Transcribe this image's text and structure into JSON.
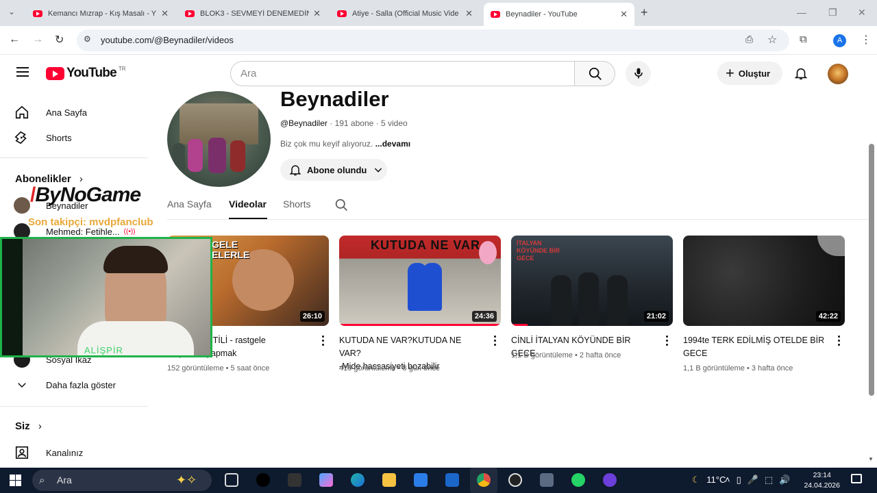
{
  "browser": {
    "tabs": [
      {
        "title": "Kemancı Mızrap - Kış Masalı - Y"
      },
      {
        "title": "BLOK3 - SEVMEYİ DENEMEDİN"
      },
      {
        "title": "Atiye - Salla (Official Music Vide"
      },
      {
        "title": "Beynadiler - YouTube"
      }
    ],
    "url": "youtube.com/@Beynadiler/videos",
    "profile_initial": "A"
  },
  "masthead": {
    "logo_text": "YouTube",
    "region": "TR",
    "search_placeholder": "Ara",
    "create_label": "Oluştur"
  },
  "sidebar": {
    "home": "Ana Sayfa",
    "shorts": "Shorts",
    "subscriptions_title": "Abonelikler",
    "subscriptions": [
      {
        "name": "Beynadiler"
      },
      {
        "name": "Mehmed: Fetihle..."
      },
      {
        "name": "Sosyal İkaz"
      }
    ],
    "show_more": "Daha fazla göster",
    "you_title": "Siz",
    "your_channel": "Kanalınız"
  },
  "channel": {
    "name": "Beynadiler",
    "handle": "@Beynadiler",
    "subscribers": "191 abone",
    "video_count": "5 video",
    "description": "Biz çok mu keyif alıyoruz.",
    "more": "...devamı",
    "subscribed_label": "Abone olundu",
    "tabs": [
      "Ana Sayfa",
      "Videolar",
      "Shorts"
    ],
    "active_tab": "Videolar"
  },
  "videos": [
    {
      "title_line1": "ME GARANTİLİ - rastgele",
      "title_line2": "rle yemek yapmak",
      "duration": "26:10",
      "views": "152 görüntüleme",
      "age": "5 saat önce",
      "thumb_text": "GELE ELERLE"
    },
    {
      "title_line1": "KUTUDA NE VAR?KUTUDA NE VAR?",
      "title_line2": "-Mide hassasiyeti bozabilir",
      "duration": "24:36",
      "views": "416 görüntüleme",
      "age": "8 gün önce",
      "thumb_text": "KUTUDA NE VAR"
    },
    {
      "title_line1": "CİNLİ İTALYAN KÖYÜNDE BİR GECE",
      "title_line2": "",
      "duration": "21:02",
      "views": "1,1 B görüntüleme",
      "age": "2 hafta önce",
      "thumb_text": "İTALYAN KÖYÜNDE BİR GECE"
    },
    {
      "title_line1": "1994te TERK EDİLMİŞ OTELDE BİR",
      "title_line2": "GECE",
      "duration": "42:22",
      "views": "1,1 B görüntüleme",
      "age": "3 hafta önce",
      "thumb_text": ""
    }
  ],
  "overlay": {
    "brand": "ByNoGame",
    "follower_text": "Son takipçi: mvdpfanclub",
    "webcam_name": "ALİŞPİR"
  },
  "taskbar": {
    "search_placeholder": "Ara",
    "temperature": "11°C",
    "time": "23:14",
    "date": "24.04.2026"
  },
  "colors": {
    "youtube_red": "#ff0033",
    "webcam_border": "#1fb34a",
    "follower_text": "#e8a83a",
    "taskbar_bg": "#0e1a2e"
  }
}
